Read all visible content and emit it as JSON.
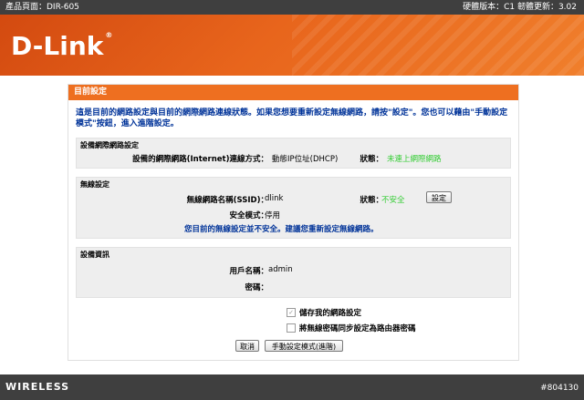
{
  "topbar": {
    "product": "產品頁面：DIR-605",
    "version": "硬體版本：C1  韌體更新：3.02"
  },
  "brand": {
    "logo": "D-Link",
    "reg_mark": "®"
  },
  "panel": {
    "title": "目前設定",
    "intro": "這是目前的網路設定與目前的網際網路連線狀態。如果您想要重新設定無線網路，請按\"設定\"。您也可以藉由\"手動設定模式\"按鈕，進入進階設定。",
    "internet": {
      "title": "設備網際網路設定",
      "conn_label": "設備的網際網路(Internet)連線方式：",
      "conn_value": "動態IP位址(DHCP)",
      "status_label": "狀態：",
      "status_value": "未連上網際網路"
    },
    "wireless": {
      "title": "無線設定",
      "ssid_label": "無線網路名稱(SSID)：",
      "ssid_value": "dlink",
      "status_label": "狀態：",
      "status_value": "不安全",
      "setup_button": "設定",
      "security_label": "安全模式：",
      "security_value": "停用",
      "warning": "您目前的無線設定並不安全。建議您重新設定無線網路。"
    },
    "device": {
      "title": "設備資訊",
      "user_label": "用戶名稱：",
      "user_value": "admin",
      "password_label": "密碼：",
      "password_value": ""
    },
    "options": {
      "save_label": "儲存我的網路設定",
      "save_checked": true,
      "sync_label": "將無線密碼同步設定為路由器密碼",
      "sync_checked": false
    },
    "buttons": {
      "cancel": "取消",
      "manual": "手動設定模式(進階)"
    }
  },
  "footer": {
    "brand": "WIRELESS",
    "tag": "#804130"
  }
}
